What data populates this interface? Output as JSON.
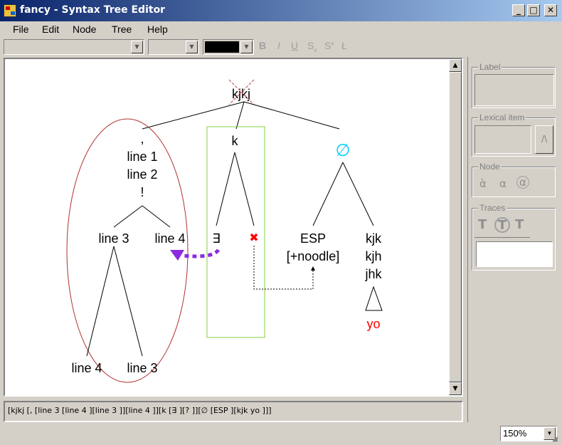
{
  "window": {
    "title": "fancy - Syntax Tree Editor",
    "minimize": "_",
    "maximize": "□",
    "close": "✕"
  },
  "menu": [
    "File",
    "Edit",
    "Node",
    "Tree",
    "Help"
  ],
  "toolbar": {
    "font_value": "",
    "size_value": "",
    "color_value": "#000000",
    "bold": "B",
    "italic": "I",
    "underline": "U",
    "subscript": "S",
    "subscript_mark": "s",
    "superscript": "S",
    "superscript_mark": "s",
    "strikethrough": "Ł"
  },
  "tree": {
    "root": "kjkj",
    "left_node_lines": [
      ",",
      "line 1",
      "line 2",
      "!"
    ],
    "line3": "line 3",
    "line4": "line 4",
    "leaf_line4": "line 4",
    "leaf_line3": "line 3",
    "k": "k",
    "exists": "∃",
    "cross": "✖",
    "empty": "∅",
    "esp": "ESP",
    "noodle": "[+noodle]",
    "kjk_lines": [
      "kjk",
      "kjh",
      "jhk"
    ],
    "yo": "yo"
  },
  "colors": {
    "ellipse": "#b03030",
    "box": "#80d040",
    "empty": "#00ccff",
    "arrow": "#8a2be2",
    "cross": "#ff0000",
    "yo": "#ff0000",
    "root_cross": "#d08080"
  },
  "bracket_text": "[kjkj [, [line 3 [line 4 ][line 3 ]][line 4 ]][k [∃ ][? ]][∅ [ESP ][kjk yo ]]]",
  "panel": {
    "label_title": "Label",
    "lexical_title": "Lexical item",
    "lexical_button": "/\\",
    "node_title": "Node",
    "node_icons": [
      "ὰ",
      "α",
      "α"
    ],
    "traces_title": "Traces",
    "traces_icons": [
      "T",
      "T",
      "T"
    ]
  },
  "zoom": "150%"
}
